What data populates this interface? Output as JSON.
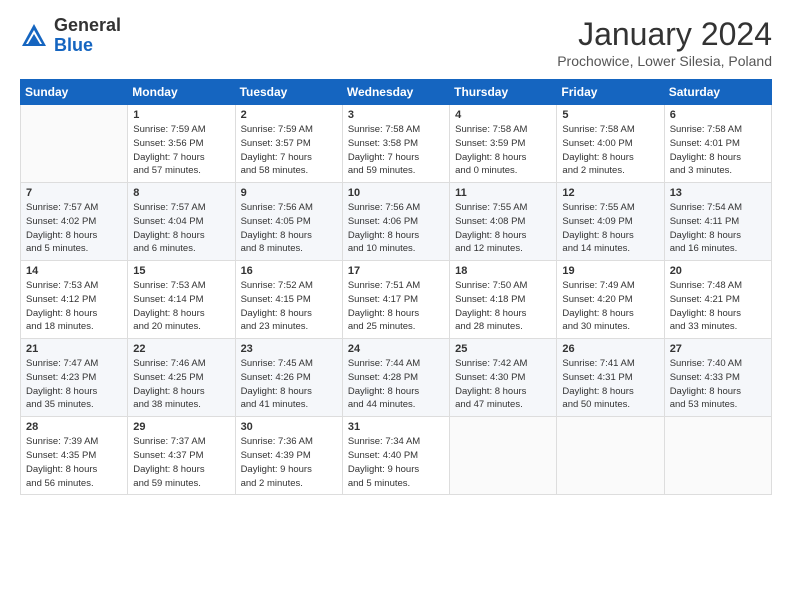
{
  "logo": {
    "general": "General",
    "blue": "Blue"
  },
  "header": {
    "month": "January 2024",
    "location": "Prochowice, Lower Silesia, Poland"
  },
  "weekdays": [
    "Sunday",
    "Monday",
    "Tuesday",
    "Wednesday",
    "Thursday",
    "Friday",
    "Saturday"
  ],
  "weeks": [
    [
      {
        "day": "",
        "info": ""
      },
      {
        "day": "1",
        "info": "Sunrise: 7:59 AM\nSunset: 3:56 PM\nDaylight: 7 hours\nand 57 minutes."
      },
      {
        "day": "2",
        "info": "Sunrise: 7:59 AM\nSunset: 3:57 PM\nDaylight: 7 hours\nand 58 minutes."
      },
      {
        "day": "3",
        "info": "Sunrise: 7:58 AM\nSunset: 3:58 PM\nDaylight: 7 hours\nand 59 minutes."
      },
      {
        "day": "4",
        "info": "Sunrise: 7:58 AM\nSunset: 3:59 PM\nDaylight: 8 hours\nand 0 minutes."
      },
      {
        "day": "5",
        "info": "Sunrise: 7:58 AM\nSunset: 4:00 PM\nDaylight: 8 hours\nand 2 minutes."
      },
      {
        "day": "6",
        "info": "Sunrise: 7:58 AM\nSunset: 4:01 PM\nDaylight: 8 hours\nand 3 minutes."
      }
    ],
    [
      {
        "day": "7",
        "info": "Sunrise: 7:57 AM\nSunset: 4:02 PM\nDaylight: 8 hours\nand 5 minutes."
      },
      {
        "day": "8",
        "info": "Sunrise: 7:57 AM\nSunset: 4:04 PM\nDaylight: 8 hours\nand 6 minutes."
      },
      {
        "day": "9",
        "info": "Sunrise: 7:56 AM\nSunset: 4:05 PM\nDaylight: 8 hours\nand 8 minutes."
      },
      {
        "day": "10",
        "info": "Sunrise: 7:56 AM\nSunset: 4:06 PM\nDaylight: 8 hours\nand 10 minutes."
      },
      {
        "day": "11",
        "info": "Sunrise: 7:55 AM\nSunset: 4:08 PM\nDaylight: 8 hours\nand 12 minutes."
      },
      {
        "day": "12",
        "info": "Sunrise: 7:55 AM\nSunset: 4:09 PM\nDaylight: 8 hours\nand 14 minutes."
      },
      {
        "day": "13",
        "info": "Sunrise: 7:54 AM\nSunset: 4:11 PM\nDaylight: 8 hours\nand 16 minutes."
      }
    ],
    [
      {
        "day": "14",
        "info": "Sunrise: 7:53 AM\nSunset: 4:12 PM\nDaylight: 8 hours\nand 18 minutes."
      },
      {
        "day": "15",
        "info": "Sunrise: 7:53 AM\nSunset: 4:14 PM\nDaylight: 8 hours\nand 20 minutes."
      },
      {
        "day": "16",
        "info": "Sunrise: 7:52 AM\nSunset: 4:15 PM\nDaylight: 8 hours\nand 23 minutes."
      },
      {
        "day": "17",
        "info": "Sunrise: 7:51 AM\nSunset: 4:17 PM\nDaylight: 8 hours\nand 25 minutes."
      },
      {
        "day": "18",
        "info": "Sunrise: 7:50 AM\nSunset: 4:18 PM\nDaylight: 8 hours\nand 28 minutes."
      },
      {
        "day": "19",
        "info": "Sunrise: 7:49 AM\nSunset: 4:20 PM\nDaylight: 8 hours\nand 30 minutes."
      },
      {
        "day": "20",
        "info": "Sunrise: 7:48 AM\nSunset: 4:21 PM\nDaylight: 8 hours\nand 33 minutes."
      }
    ],
    [
      {
        "day": "21",
        "info": "Sunrise: 7:47 AM\nSunset: 4:23 PM\nDaylight: 8 hours\nand 35 minutes."
      },
      {
        "day": "22",
        "info": "Sunrise: 7:46 AM\nSunset: 4:25 PM\nDaylight: 8 hours\nand 38 minutes."
      },
      {
        "day": "23",
        "info": "Sunrise: 7:45 AM\nSunset: 4:26 PM\nDaylight: 8 hours\nand 41 minutes."
      },
      {
        "day": "24",
        "info": "Sunrise: 7:44 AM\nSunset: 4:28 PM\nDaylight: 8 hours\nand 44 minutes."
      },
      {
        "day": "25",
        "info": "Sunrise: 7:42 AM\nSunset: 4:30 PM\nDaylight: 8 hours\nand 47 minutes."
      },
      {
        "day": "26",
        "info": "Sunrise: 7:41 AM\nSunset: 4:31 PM\nDaylight: 8 hours\nand 50 minutes."
      },
      {
        "day": "27",
        "info": "Sunrise: 7:40 AM\nSunset: 4:33 PM\nDaylight: 8 hours\nand 53 minutes."
      }
    ],
    [
      {
        "day": "28",
        "info": "Sunrise: 7:39 AM\nSunset: 4:35 PM\nDaylight: 8 hours\nand 56 minutes."
      },
      {
        "day": "29",
        "info": "Sunrise: 7:37 AM\nSunset: 4:37 PM\nDaylight: 8 hours\nand 59 minutes."
      },
      {
        "day": "30",
        "info": "Sunrise: 7:36 AM\nSunset: 4:39 PM\nDaylight: 9 hours\nand 2 minutes."
      },
      {
        "day": "31",
        "info": "Sunrise: 7:34 AM\nSunset: 4:40 PM\nDaylight: 9 hours\nand 5 minutes."
      },
      {
        "day": "",
        "info": ""
      },
      {
        "day": "",
        "info": ""
      },
      {
        "day": "",
        "info": ""
      }
    ]
  ]
}
